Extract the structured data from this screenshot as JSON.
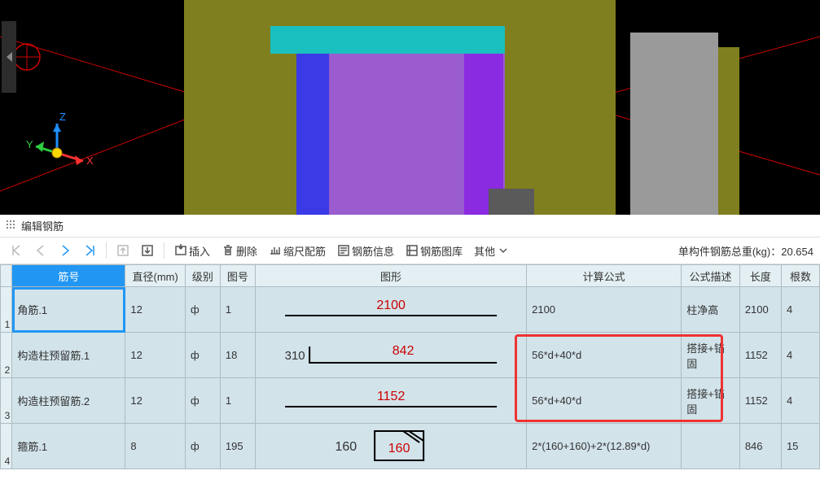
{
  "viewport": {
    "axes": {
      "x": "X",
      "y": "Y",
      "z": "Z"
    }
  },
  "panel": {
    "title": "编辑钢筋"
  },
  "toolbar": {
    "insert": "插入",
    "delete": "删除",
    "ruler": "缩尺配筋",
    "rebar_info": "钢筋信息",
    "rebar_lib": "钢筋图库",
    "other": "其他",
    "total_label": "单构件钢筋总重(kg)：",
    "total_value": "20.654"
  },
  "columns": {
    "c1": "筋号",
    "c2": "直径(mm)",
    "c3": "级别",
    "c4": "图号",
    "c5": "图形",
    "c6": "计算公式",
    "c7": "公式描述",
    "c8": "长度",
    "c9": "根数"
  },
  "rows": [
    {
      "rn": "1",
      "name": "角筋.1",
      "dia": "12",
      "grade": "ф",
      "fig": "1",
      "shape_main": "2100",
      "shape_side": "",
      "formula": "2100",
      "desc": "柱净高",
      "len": "2100",
      "cnt": "4"
    },
    {
      "rn": "2",
      "name": "构造柱预留筋.1",
      "dia": "12",
      "grade": "ф",
      "fig": "18",
      "shape_main": "842",
      "shape_side": "310",
      "formula": "56*d+40*d",
      "desc": "搭接+锚固",
      "len": "1152",
      "cnt": "4"
    },
    {
      "rn": "3",
      "name": "构造柱预留筋.2",
      "dia": "12",
      "grade": "ф",
      "fig": "1",
      "shape_main": "1152",
      "shape_side": "",
      "formula": "56*d+40*d",
      "desc": "搭接+锚固",
      "len": "1152",
      "cnt": "4"
    },
    {
      "rn": "4",
      "name": "箍筋.1",
      "dia": "8",
      "grade": "ф",
      "fig": "195",
      "shape_main": "160",
      "shape_side": "160",
      "formula": "2*(160+160)+2*(12.89*d)",
      "desc": "",
      "len": "846",
      "cnt": "15"
    }
  ],
  "chart_data": {
    "type": "table",
    "title": "编辑钢筋",
    "columns": [
      "筋号",
      "直径(mm)",
      "级别",
      "图号",
      "计算公式",
      "公式描述",
      "长度",
      "根数"
    ],
    "rows": [
      [
        "角筋.1",
        "12",
        "ф",
        "1",
        "2100",
        "柱净高",
        "2100",
        "4"
      ],
      [
        "构造柱预留筋.1",
        "12",
        "ф",
        "18",
        "56*d+40*d",
        "搭接+锚固",
        "1152",
        "4"
      ],
      [
        "构造柱预留筋.2",
        "12",
        "ф",
        "1",
        "56*d+40*d",
        "搭接+锚固",
        "1152",
        "4"
      ],
      [
        "箍筋.1",
        "8",
        "ф",
        "195",
        "2*(160+160)+2*(12.89*d)",
        "",
        "846",
        "15"
      ]
    ],
    "total_weight_kg": 20.654
  }
}
